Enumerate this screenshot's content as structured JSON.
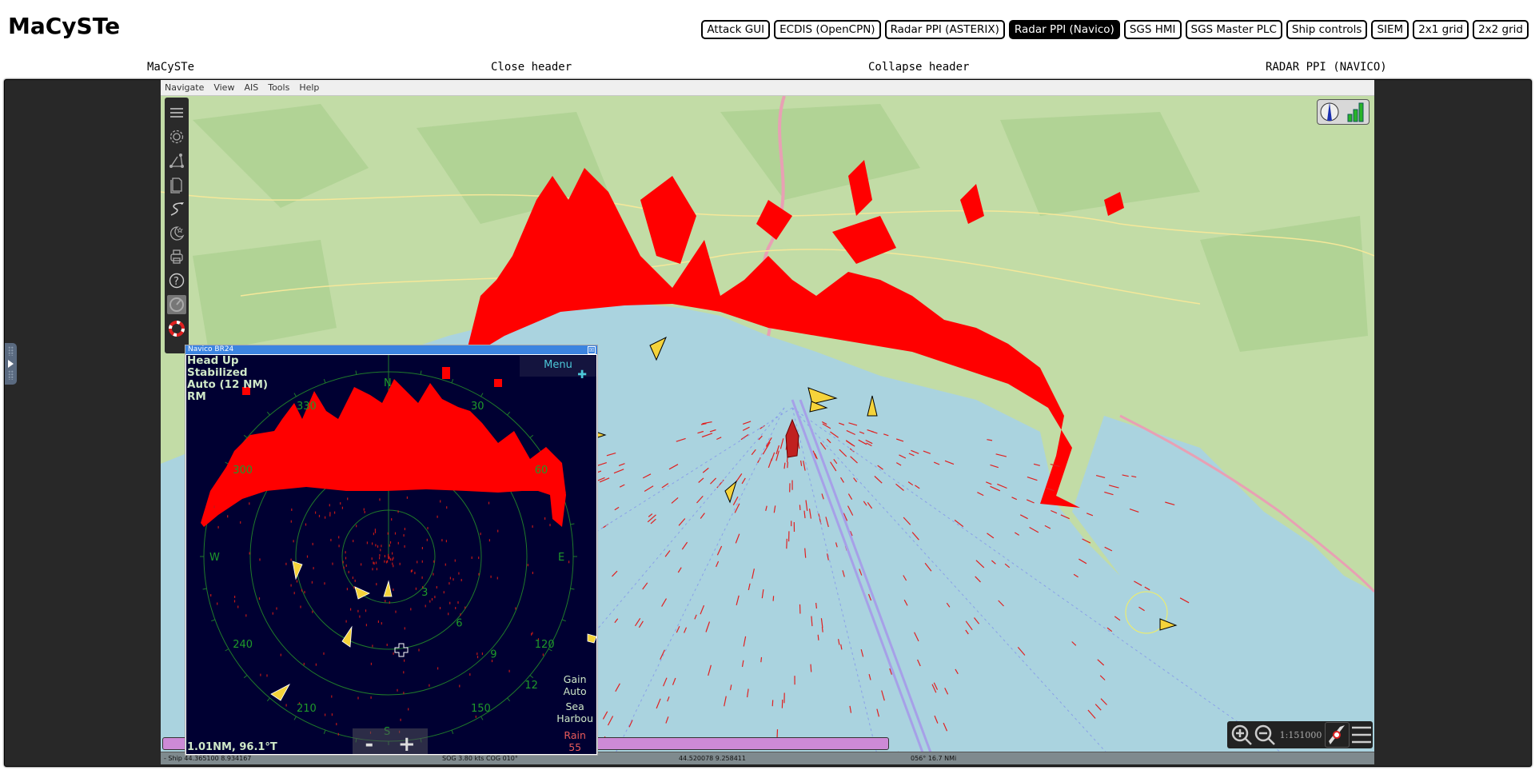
{
  "app": {
    "title": "MaCySTe"
  },
  "nav": {
    "buttons": [
      {
        "label": "Attack GUI",
        "active": false
      },
      {
        "label": "ECDIS (OpenCPN)",
        "active": false
      },
      {
        "label": "Radar PPI (ASTERIX)",
        "active": false
      },
      {
        "label": "Radar PPI (Navico)",
        "active": true
      },
      {
        "label": "SGS HMI",
        "active": false
      },
      {
        "label": "SGS Master PLC",
        "active": false
      },
      {
        "label": "Ship controls",
        "active": false
      },
      {
        "label": "SIEM",
        "active": false
      },
      {
        "label": "2x1 grid",
        "active": false
      },
      {
        "label": "2x2 grid",
        "active": false
      }
    ]
  },
  "header": {
    "brand": "MaCySTe",
    "close": "Close header",
    "collapse": "Collapse header",
    "current": "RADAR PPI (NAVICO)"
  },
  "opencpn": {
    "menu": [
      "Navigate",
      "View",
      "AIS",
      "Tools",
      "Help"
    ],
    "toolbar_icons": [
      "menu-icon",
      "gear-icon",
      "route-icon",
      "document-icon",
      "track-icon",
      "night-mode-icon",
      "print-icon",
      "help-icon",
      "radar-icon",
      "lifebuoy-icon"
    ],
    "scale": "1:151000",
    "status": {
      "ship": "- Ship 44.365100   8.934167",
      "sog_cog": "SOG 3.80 kts   COG 010°",
      "cursor_pos": "44.520078   9.258411",
      "bearing_dist": "056°   16.7 NMi"
    },
    "colors": {
      "sea": "#aad3df",
      "land": "#c2dca6",
      "radar_echo": "#ff0000",
      "ais_target": "#f5d33a"
    }
  },
  "navico": {
    "window_title": "Navico BR24",
    "close_label": "☒",
    "info": [
      "Head Up",
      "Stabilized",
      "Auto (12 NM)",
      "RM"
    ],
    "menu_label": "Menu",
    "readout": "1.01NM, 96.1°T",
    "gain_label": "Gain",
    "gain_value": "Auto",
    "sea_label": "Sea",
    "sea_value": "Harbou",
    "rain_label": "Rain",
    "rain_value": "55",
    "zoom_out": "-",
    "zoom_in": "+",
    "bearing_labels": [
      "N",
      "30",
      "60",
      "E",
      "120",
      "150",
      "S",
      "210",
      "240",
      "W",
      "300",
      "330"
    ],
    "range_labels": [
      "3",
      "6",
      "9",
      "12"
    ]
  }
}
